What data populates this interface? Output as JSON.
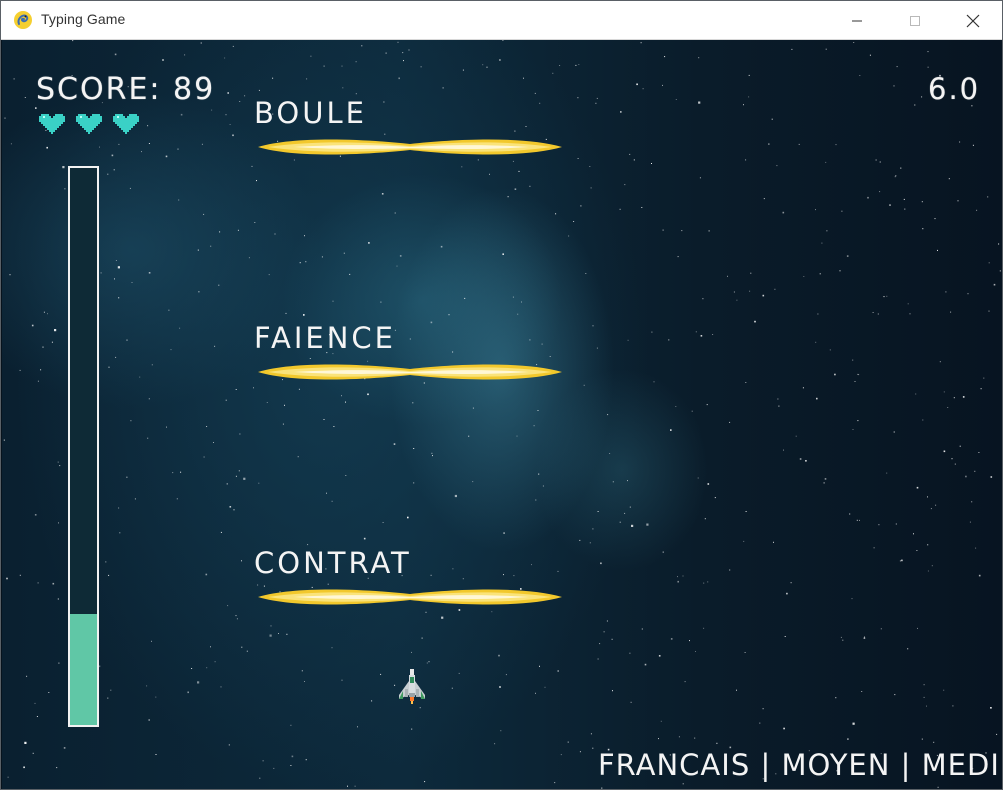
{
  "window": {
    "title": "Typing Game",
    "icon": "pygame-snake-icon"
  },
  "hud": {
    "score_label": "SCORE: 89",
    "timer": "6.0",
    "lives": 3,
    "heart_color": "#3ad1c6",
    "gauge_level": 0.2,
    "gauge_color": "#60c7a6"
  },
  "words": [
    {
      "text": "BOULE"
    },
    {
      "text": "FAIENCE"
    },
    {
      "text": "CONTRAT"
    }
  ],
  "footer": {
    "text": "FRANCAIS | MOYEN | MEDIUM"
  },
  "colors": {
    "beam": "#f6d44a",
    "text": "#f4f4f4"
  }
}
